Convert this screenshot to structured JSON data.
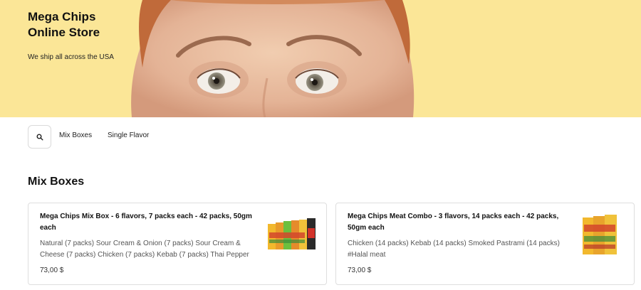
{
  "header": {
    "title": "Mega Chips Online Store",
    "tagline": "We ship all across the USA"
  },
  "nav": {
    "search_icon": "search-icon",
    "links": [
      "Mix Boxes",
      "Single Flavor"
    ]
  },
  "section": {
    "title": "Mix Boxes"
  },
  "products": [
    {
      "name": "Mega Chips Mix Box - 6 flavors, 7 packs each - 42 packs, 50gm each",
      "description": "Natural (7 packs) Sour Cream & Onion (7 packs) Sour Cream & Cheese (7 packs) Chicken (7 packs) Kebab (7 packs) Thai Pepper …",
      "price": "73,00 $"
    },
    {
      "name": "Mega Chips Meat Combo - 3 flavors, 14 packs each - 42 packs, 50gm each",
      "description": "Chicken (14 packs) Kebab (14 packs) Smoked Pastrami (14 packs) #Halal meat",
      "price": "73,00 $"
    }
  ],
  "colors": {
    "hero_bg": "#fbe697",
    "card_border": "#dedede"
  }
}
